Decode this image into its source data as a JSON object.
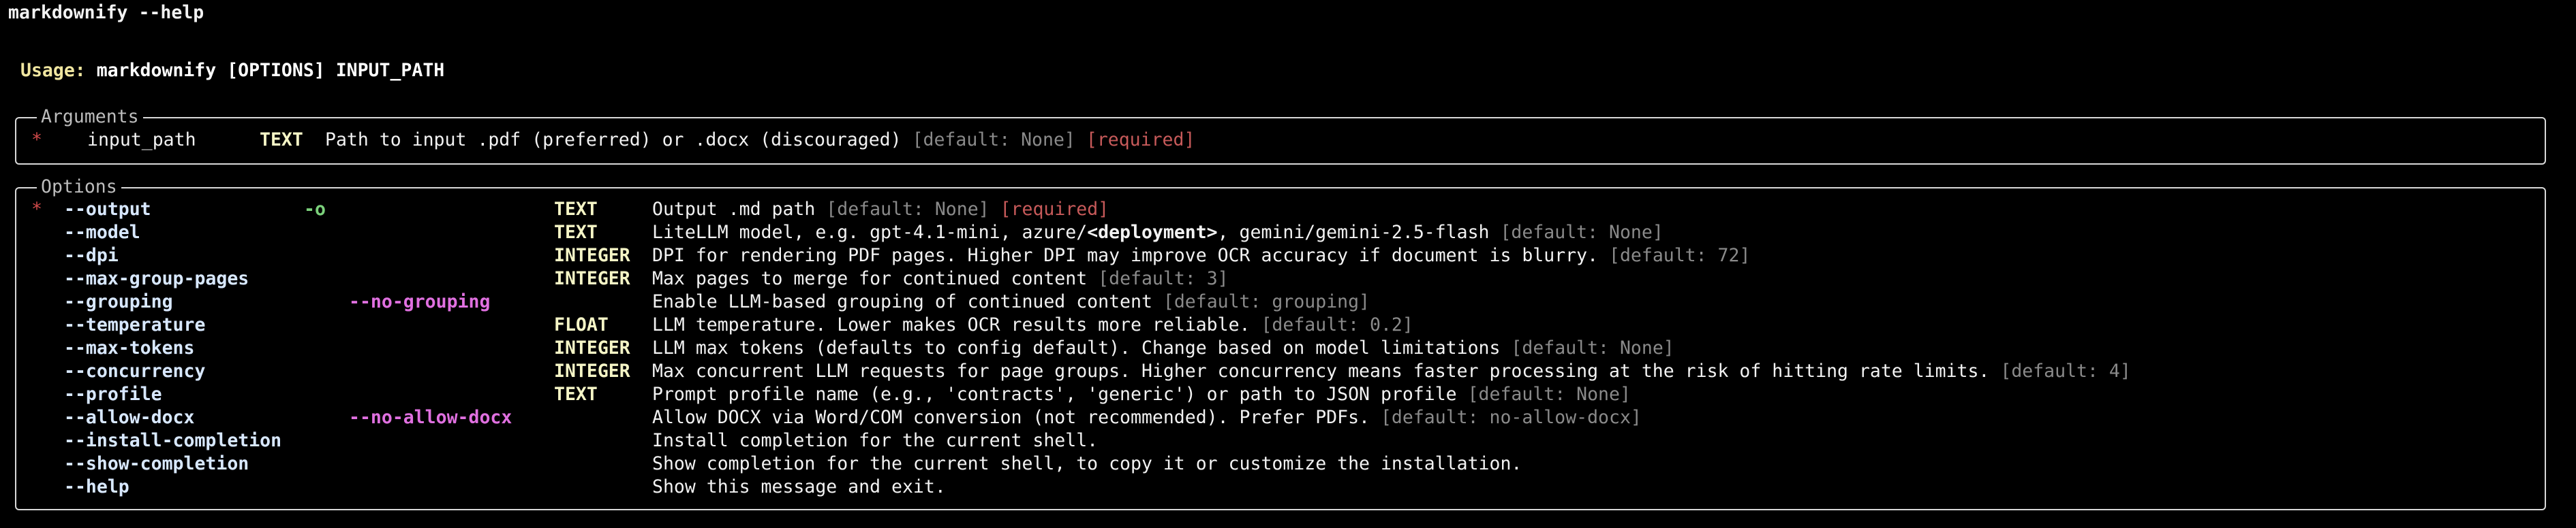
{
  "prompt": "markdownify --help",
  "usage": {
    "label": "Usage:",
    "text": "markdownify [OPTIONS] INPUT_PATH"
  },
  "arguments": {
    "title": "Arguments",
    "rows": [
      {
        "marker": "*",
        "name": "input_path",
        "type": "TEXT",
        "description": "Path to input .pdf (preferred) or .docx (discouraged)",
        "default": "[default: None]",
        "required": "[required]"
      }
    ]
  },
  "options": {
    "title": "Options",
    "rows": [
      {
        "marker": "*",
        "name": "--output",
        "short": "-o",
        "negation": "",
        "type": "TEXT",
        "description": "Output .md path",
        "default": "[default: None]",
        "required": "[required]"
      },
      {
        "marker": "",
        "name": "--model",
        "short": "",
        "negation": "",
        "type": "TEXT",
        "desc_pre": "LiteLLM model, e.g. gpt-4.1-mini, azure/",
        "desc_bold": "<deployment>",
        "desc_post": ", gemini/gemini-2.5-flash",
        "default": "[default: None]",
        "required": ""
      },
      {
        "marker": "",
        "name": "--dpi",
        "short": "",
        "negation": "",
        "type": "INTEGER",
        "description": "DPI for rendering PDF pages. Higher DPI may improve OCR accuracy if document is blurry.",
        "default": "[default: 72]",
        "required": ""
      },
      {
        "marker": "",
        "name": "--max-group-pages",
        "short": "",
        "negation": "",
        "type": "INTEGER",
        "description": "Max pages to merge for continued content",
        "default": "[default: 3]",
        "required": ""
      },
      {
        "marker": "",
        "name": "--grouping",
        "short": "",
        "negation": "--no-grouping",
        "type": "",
        "description": "Enable LLM-based grouping of continued content",
        "default": "[default: grouping]",
        "required": ""
      },
      {
        "marker": "",
        "name": "--temperature",
        "short": "",
        "negation": "",
        "type": "FLOAT",
        "description": "LLM temperature. Lower makes OCR results more reliable.",
        "default": "[default: 0.2]",
        "required": ""
      },
      {
        "marker": "",
        "name": "--max-tokens",
        "short": "",
        "negation": "",
        "type": "INTEGER",
        "description": "LLM max tokens (defaults to config default). Change based on model limitations",
        "default": "[default: None]",
        "required": ""
      },
      {
        "marker": "",
        "name": "--concurrency",
        "short": "",
        "negation": "",
        "type": "INTEGER",
        "description": "Max concurrent LLM requests for page groups. Higher concurrency means faster processing at the risk of hitting rate limits.",
        "default": "[default: 4]",
        "required": ""
      },
      {
        "marker": "",
        "name": "--profile",
        "short": "",
        "negation": "",
        "type": "TEXT",
        "description": "Prompt profile name (e.g., 'contracts', 'generic') or path to JSON profile",
        "default": "[default: None]",
        "required": ""
      },
      {
        "marker": "",
        "name": "--allow-docx",
        "short": "",
        "negation": "--no-allow-docx",
        "type": "",
        "description": "Allow DOCX via Word/COM conversion (not recommended). Prefer PDFs.",
        "default": "[default: no-allow-docx]",
        "required": ""
      },
      {
        "marker": "",
        "name": "--install-completion",
        "short": "",
        "negation": "",
        "type": "",
        "description": "Install completion for the current shell.",
        "default": "",
        "required": ""
      },
      {
        "marker": "",
        "name": "--show-completion",
        "short": "",
        "negation": "",
        "type": "",
        "description": "Show completion for the current shell, to copy it or customize the installation.",
        "default": "",
        "required": ""
      },
      {
        "marker": "",
        "name": "--help",
        "short": "",
        "negation": "",
        "type": "",
        "description": "Show this message and exit.",
        "default": "",
        "required": ""
      }
    ]
  }
}
